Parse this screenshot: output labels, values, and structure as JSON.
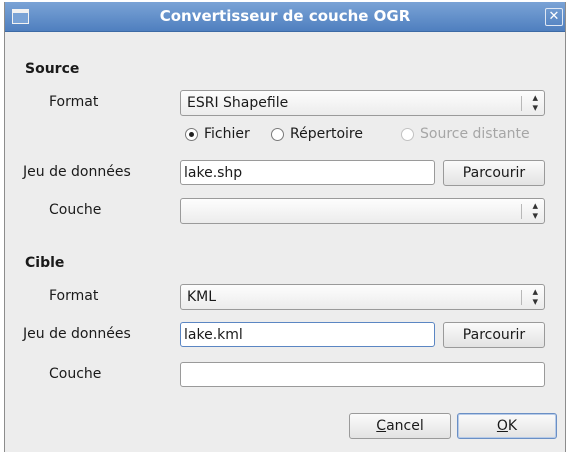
{
  "window": {
    "title": "Convertisseur de couche OGR",
    "close_glyph": "✕",
    "menu_icon": "window-menu-icon"
  },
  "source": {
    "title": "Source",
    "format_label": "Format",
    "format_value": "ESRI Shapefile",
    "radio_options": [
      {
        "label": "Fichier",
        "checked": true,
        "disabled": false
      },
      {
        "label": "Répertoire",
        "checked": false,
        "disabled": false
      },
      {
        "label": "Source distante",
        "checked": false,
        "disabled": true
      }
    ],
    "dataset_label": "Jeu de données",
    "dataset_value": "lake.shp",
    "browse_label": "Parcourir",
    "layer_label": "Couche",
    "layer_value": ""
  },
  "target": {
    "title": "Cible",
    "format_label": "Format",
    "format_value": "KML",
    "dataset_label": "Jeu de données",
    "dataset_value": "lake.kml",
    "browse_label": "Parcourir",
    "layer_label": "Couche",
    "layer_value": ""
  },
  "buttons": {
    "cancel_label": "Cancel",
    "ok_label": "OK"
  },
  "combo_arrow": {
    "up": "▴",
    "down": "▾"
  }
}
